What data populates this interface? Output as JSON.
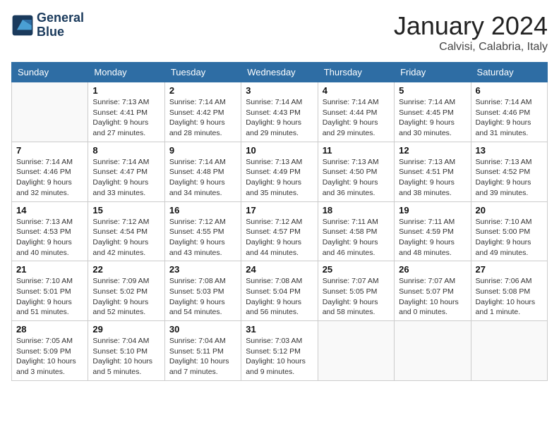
{
  "header": {
    "logo_line1": "General",
    "logo_line2": "Blue",
    "month": "January 2024",
    "location": "Calvisi, Calabria, Italy"
  },
  "columns": [
    "Sunday",
    "Monday",
    "Tuesday",
    "Wednesday",
    "Thursday",
    "Friday",
    "Saturday"
  ],
  "weeks": [
    [
      {
        "day": "",
        "details": ""
      },
      {
        "day": "1",
        "details": "Sunrise: 7:13 AM\nSunset: 4:41 PM\nDaylight: 9 hours\nand 27 minutes."
      },
      {
        "day": "2",
        "details": "Sunrise: 7:14 AM\nSunset: 4:42 PM\nDaylight: 9 hours\nand 28 minutes."
      },
      {
        "day": "3",
        "details": "Sunrise: 7:14 AM\nSunset: 4:43 PM\nDaylight: 9 hours\nand 29 minutes."
      },
      {
        "day": "4",
        "details": "Sunrise: 7:14 AM\nSunset: 4:44 PM\nDaylight: 9 hours\nand 29 minutes."
      },
      {
        "day": "5",
        "details": "Sunrise: 7:14 AM\nSunset: 4:45 PM\nDaylight: 9 hours\nand 30 minutes."
      },
      {
        "day": "6",
        "details": "Sunrise: 7:14 AM\nSunset: 4:46 PM\nDaylight: 9 hours\nand 31 minutes."
      }
    ],
    [
      {
        "day": "7",
        "details": "Sunrise: 7:14 AM\nSunset: 4:46 PM\nDaylight: 9 hours\nand 32 minutes."
      },
      {
        "day": "8",
        "details": "Sunrise: 7:14 AM\nSunset: 4:47 PM\nDaylight: 9 hours\nand 33 minutes."
      },
      {
        "day": "9",
        "details": "Sunrise: 7:14 AM\nSunset: 4:48 PM\nDaylight: 9 hours\nand 34 minutes."
      },
      {
        "day": "10",
        "details": "Sunrise: 7:13 AM\nSunset: 4:49 PM\nDaylight: 9 hours\nand 35 minutes."
      },
      {
        "day": "11",
        "details": "Sunrise: 7:13 AM\nSunset: 4:50 PM\nDaylight: 9 hours\nand 36 minutes."
      },
      {
        "day": "12",
        "details": "Sunrise: 7:13 AM\nSunset: 4:51 PM\nDaylight: 9 hours\nand 38 minutes."
      },
      {
        "day": "13",
        "details": "Sunrise: 7:13 AM\nSunset: 4:52 PM\nDaylight: 9 hours\nand 39 minutes."
      }
    ],
    [
      {
        "day": "14",
        "details": "Sunrise: 7:13 AM\nSunset: 4:53 PM\nDaylight: 9 hours\nand 40 minutes."
      },
      {
        "day": "15",
        "details": "Sunrise: 7:12 AM\nSunset: 4:54 PM\nDaylight: 9 hours\nand 42 minutes."
      },
      {
        "day": "16",
        "details": "Sunrise: 7:12 AM\nSunset: 4:55 PM\nDaylight: 9 hours\nand 43 minutes."
      },
      {
        "day": "17",
        "details": "Sunrise: 7:12 AM\nSunset: 4:57 PM\nDaylight: 9 hours\nand 44 minutes."
      },
      {
        "day": "18",
        "details": "Sunrise: 7:11 AM\nSunset: 4:58 PM\nDaylight: 9 hours\nand 46 minutes."
      },
      {
        "day": "19",
        "details": "Sunrise: 7:11 AM\nSunset: 4:59 PM\nDaylight: 9 hours\nand 48 minutes."
      },
      {
        "day": "20",
        "details": "Sunrise: 7:10 AM\nSunset: 5:00 PM\nDaylight: 9 hours\nand 49 minutes."
      }
    ],
    [
      {
        "day": "21",
        "details": "Sunrise: 7:10 AM\nSunset: 5:01 PM\nDaylight: 9 hours\nand 51 minutes."
      },
      {
        "day": "22",
        "details": "Sunrise: 7:09 AM\nSunset: 5:02 PM\nDaylight: 9 hours\nand 52 minutes."
      },
      {
        "day": "23",
        "details": "Sunrise: 7:08 AM\nSunset: 5:03 PM\nDaylight: 9 hours\nand 54 minutes."
      },
      {
        "day": "24",
        "details": "Sunrise: 7:08 AM\nSunset: 5:04 PM\nDaylight: 9 hours\nand 56 minutes."
      },
      {
        "day": "25",
        "details": "Sunrise: 7:07 AM\nSunset: 5:05 PM\nDaylight: 9 hours\nand 58 minutes."
      },
      {
        "day": "26",
        "details": "Sunrise: 7:07 AM\nSunset: 5:07 PM\nDaylight: 10 hours\nand 0 minutes."
      },
      {
        "day": "27",
        "details": "Sunrise: 7:06 AM\nSunset: 5:08 PM\nDaylight: 10 hours\nand 1 minute."
      }
    ],
    [
      {
        "day": "28",
        "details": "Sunrise: 7:05 AM\nSunset: 5:09 PM\nDaylight: 10 hours\nand 3 minutes."
      },
      {
        "day": "29",
        "details": "Sunrise: 7:04 AM\nSunset: 5:10 PM\nDaylight: 10 hours\nand 5 minutes."
      },
      {
        "day": "30",
        "details": "Sunrise: 7:04 AM\nSunset: 5:11 PM\nDaylight: 10 hours\nand 7 minutes."
      },
      {
        "day": "31",
        "details": "Sunrise: 7:03 AM\nSunset: 5:12 PM\nDaylight: 10 hours\nand 9 minutes."
      },
      {
        "day": "",
        "details": ""
      },
      {
        "day": "",
        "details": ""
      },
      {
        "day": "",
        "details": ""
      }
    ]
  ]
}
